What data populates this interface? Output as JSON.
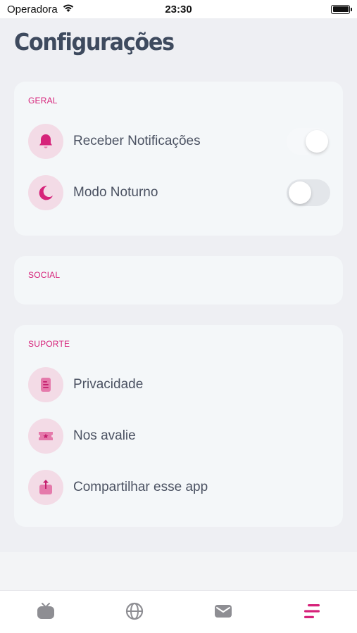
{
  "status_bar": {
    "carrier": "Operadora",
    "time": "23:30"
  },
  "page": {
    "title": "Configurações"
  },
  "sections": {
    "general": {
      "label": "GERAL",
      "items": [
        {
          "label": "Receber Notificações",
          "icon": "bell-icon",
          "toggle_on": true
        },
        {
          "label": "Modo Noturno",
          "icon": "moon-icon",
          "toggle_on": false
        }
      ]
    },
    "social": {
      "label": "SOCIAL"
    },
    "support": {
      "label": "SUPORTE",
      "items": [
        {
          "label": "Privacidade",
          "icon": "document-icon"
        },
        {
          "label": "Nos avalie",
          "icon": "ticket-star-icon"
        },
        {
          "label": "Compartilhar esse app",
          "icon": "share-icon"
        }
      ]
    }
  },
  "tab_bar": {
    "tabs": [
      {
        "icon": "tv-icon",
        "active": false
      },
      {
        "icon": "globe-icon",
        "active": false
      },
      {
        "icon": "mail-icon",
        "active": false
      },
      {
        "icon": "menu-lines-icon",
        "active": true
      }
    ]
  },
  "colors": {
    "accent": "#d6237a",
    "icon_bg": "#f3dbe6",
    "text": "#4b5262",
    "inactive_icon": "#8e8e93"
  }
}
